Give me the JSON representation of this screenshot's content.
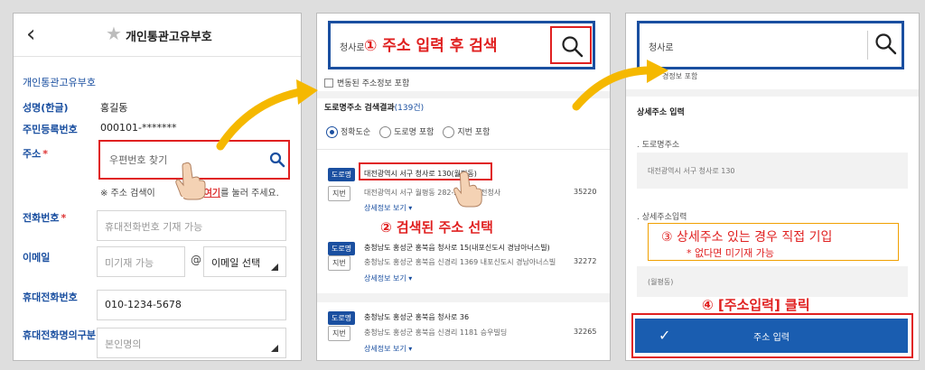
{
  "panel1": {
    "title": "개인통관고유부호",
    "section": "개인통관고유부호",
    "name_label": "성명(한글)",
    "name_value": "홍길동",
    "rrn_label": "주민등록번호",
    "rrn_value": "000101-*******",
    "address_label": "주소",
    "required_mark": "*",
    "zip_placeholder": "우편번호 찾기",
    "hint_prefix": "※ 주소 검색이",
    "hint_mid": "경우",
    "hint_link": "여기",
    "hint_suffix": "를 눌러 주세요.",
    "phone_label": "전화번호",
    "phone_placeholder": "휴대전화번호 기재 가능",
    "email_label": "이메일",
    "email_placeholder": "미기재 가능",
    "email_at": "@",
    "email_select": "이메일 선택",
    "mobile_label": "휴대전화번호",
    "mobile_value": "010-1234-5678",
    "mobile_owner_label": "휴대전화명의구분",
    "mobile_owner_value": "본인명의"
  },
  "panel2": {
    "search_value": "청사로",
    "step1": "① 주소 입력 후 검색",
    "checkbox_label": "변동된 주소정보 포함",
    "result_title": "도로명주소 검색결과",
    "result_count": "(139건)",
    "radio1": "정확도순",
    "radio2": "도로명 포함",
    "radio3": "지번 포함",
    "step2": "② 검색된 주소 선택",
    "road_tag": "도로명",
    "jibun_tag": "지번",
    "more": "상세정보 보기 ▾",
    "results": [
      {
        "road": "대전광역시 서구 청사로 130(월평동)",
        "jibun": "대전광역시 서구 월평동 282-2 정부대전청사",
        "zip": "35220"
      },
      {
        "road": "충청남도 홍성군 홍북읍 청사로 15(내포신도시 경남아너스빌)",
        "jibun": "충청남도 홍성군 홍북읍 신경리 1369 내포신도시 경남아너스빌",
        "zip": "32272"
      },
      {
        "road": "충청남도 홍성군 홍북읍 청사로 36",
        "jibun": "충청남도 홍성군 홍북읍 신경리 1181 승우빌딩",
        "zip": "32265"
      }
    ]
  },
  "panel3": {
    "search_value": "청사로",
    "checkbox_label": "경정보 포함",
    "detail_title": "상세주소 입력",
    "road_label": "도로명주소",
    "road_value": "대전광역시 서구 청사로 130",
    "detail_label": "상세주소입력",
    "step3": "③ 상세주소 있는 경우 직접 기입",
    "step3_note": "* 없다면 미기재 가능",
    "detail_value": "(월평동)",
    "step4": "④ [주소입력] 클릭",
    "button_label": "주소 입력"
  },
  "icons": {
    "back": "chevron-left-icon",
    "star": "star-icon",
    "search": "search-icon",
    "pointer": "hand-pointer-icon",
    "check": "check-icon"
  },
  "colors": {
    "brand_blue": "#1a4fa0",
    "highlight_red": "#e02020",
    "arrow_yellow": "#f5b800",
    "button_blue": "#1a5db0"
  }
}
